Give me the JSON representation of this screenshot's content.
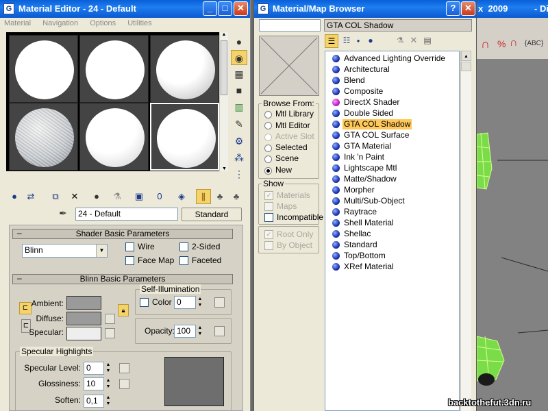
{
  "material_editor": {
    "title": "Material Editor - 24 - Default",
    "menu": [
      "Material",
      "Navigation",
      "Options",
      "Utilities"
    ],
    "material_name": "24 - Default",
    "type_button": "Standard",
    "shader_rollout": {
      "title": "Shader Basic Parameters",
      "shader": "Blinn",
      "options": [
        "Wire",
        "2-Sided",
        "Face Map",
        "Faceted"
      ]
    },
    "blinn_rollout": {
      "title": "Blinn Basic Parameters",
      "ambient_label": "Ambient:",
      "diffuse_label": "Diffuse:",
      "specular_label": "Specular:",
      "self_illum_title": "Self-Illumination",
      "color_label": "Color",
      "color_value": "0",
      "opacity_label": "Opacity:",
      "opacity_value": "100"
    },
    "specular_highlights": {
      "title": "Specular Highlights",
      "level_label": "Specular Level:",
      "level_value": "0",
      "gloss_label": "Glossiness:",
      "gloss_value": "10",
      "soften_label": "Soften:",
      "soften_value": "0,1"
    },
    "colors": {
      "ambient": "#9a9a9a",
      "diffuse": "#9a9a9a",
      "specular": "#eeeeee",
      "highlight_graph": "#6e6e6e"
    }
  },
  "behind_window": {
    "title_fragment_left": "x  2009",
    "title_fragment_right": "- Di"
  },
  "browser": {
    "title": "Material/Map Browser",
    "search_value": "",
    "current_name": "GTA COL Shadow",
    "browse_from": {
      "title": "Browse From:",
      "options": [
        {
          "label": "Mtl Library",
          "disabled": false
        },
        {
          "label": "Mtl Editor",
          "disabled": false
        },
        {
          "label": "Active Slot",
          "disabled": true
        },
        {
          "label": "Selected",
          "disabled": false
        },
        {
          "label": "Scene",
          "disabled": false
        },
        {
          "label": "New",
          "disabled": false
        }
      ],
      "selected": "New"
    },
    "show": {
      "title": "Show",
      "options": [
        {
          "label": "Materials",
          "disabled": true
        },
        {
          "label": "Maps",
          "disabled": true
        },
        {
          "label": "Incompatible",
          "disabled": false
        }
      ]
    },
    "extra": [
      {
        "label": "Root Only",
        "disabled": true
      },
      {
        "label": "By Object",
        "disabled": true
      }
    ],
    "materials": [
      {
        "label": "Advanced Lighting Override",
        "icon": "blue-sphere-icon"
      },
      {
        "label": "Architectural",
        "icon": "blue-sphere-icon"
      },
      {
        "label": "Blend",
        "icon": "blue-sphere-icon"
      },
      {
        "label": "Composite",
        "icon": "blue-sphere-icon"
      },
      {
        "label": "DirectX Shader",
        "icon": "magenta-sphere-icon"
      },
      {
        "label": "Double Sided",
        "icon": "blue-sphere-icon"
      },
      {
        "label": "GTA COL Shadow",
        "icon": "blue-sphere-icon"
      },
      {
        "label": "GTA COL Surface",
        "icon": "blue-sphere-icon"
      },
      {
        "label": "GTA Material",
        "icon": "blue-sphere-icon"
      },
      {
        "label": "Ink 'n Paint",
        "icon": "blue-sphere-icon"
      },
      {
        "label": "Lightscape Mtl",
        "icon": "blue-sphere-icon"
      },
      {
        "label": "Matte/Shadow",
        "icon": "blue-sphere-icon"
      },
      {
        "label": "Morpher",
        "icon": "blue-sphere-icon"
      },
      {
        "label": "Multi/Sub-Object",
        "icon": "blue-sphere-icon"
      },
      {
        "label": "Raytrace",
        "icon": "blue-sphere-icon"
      },
      {
        "label": "Shell Material",
        "icon": "blue-sphere-icon"
      },
      {
        "label": "Shellac",
        "icon": "blue-sphere-icon"
      },
      {
        "label": "Standard",
        "icon": "blue-sphere-icon"
      },
      {
        "label": "Top/Bottom",
        "icon": "blue-sphere-icon"
      },
      {
        "label": "XRef Material",
        "icon": "blue-sphere-icon"
      }
    ],
    "highlighted": "GTA COL Shadow"
  },
  "watermark": "backtothefut.3dn.ru"
}
